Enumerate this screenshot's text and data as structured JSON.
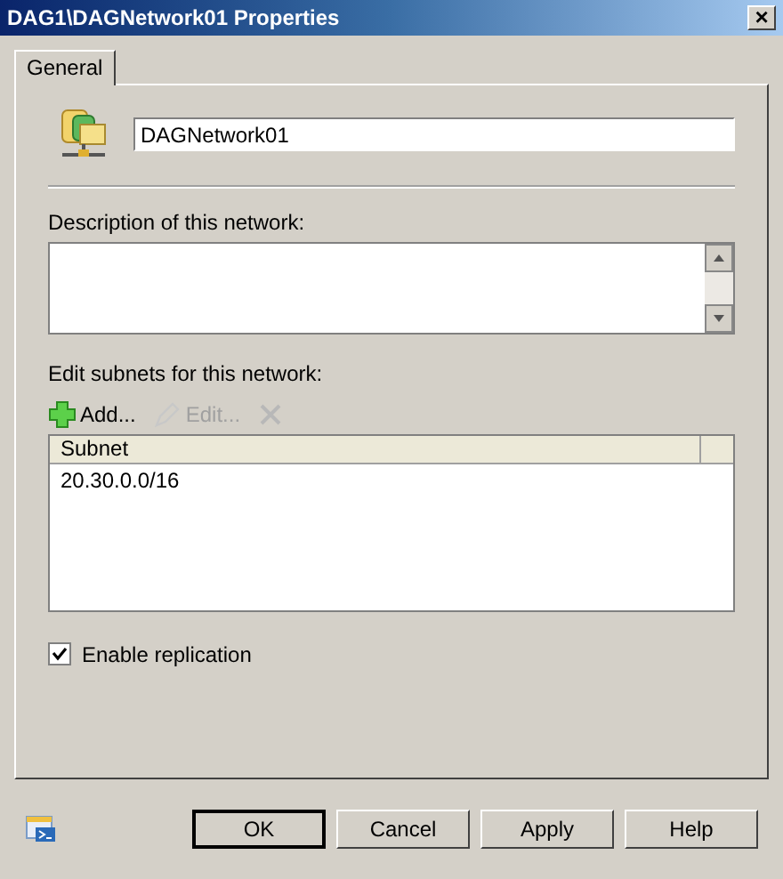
{
  "window": {
    "title": "DAG1\\DAGNetwork01 Properties",
    "close": "×"
  },
  "tabs": [
    {
      "label": "General",
      "selected": true
    }
  ],
  "name_field": {
    "value": "DAGNetwork01"
  },
  "description": {
    "label": "Description of this network:"
  },
  "subnets": {
    "label": "Edit subnets for this network:",
    "toolbar": [
      {
        "kind": "add",
        "label": "Add...",
        "disabled": false
      },
      {
        "kind": "edit",
        "label": "Edit...",
        "disabled": true
      },
      {
        "kind": "delete",
        "disabled": true
      }
    ],
    "columns": [
      "Subnet"
    ],
    "rows": [
      {
        "cells": [
          "20.30.0.0/16"
        ],
        "selected": false
      }
    ]
  },
  "enable_replication": {
    "label": "Enable replication",
    "checked": true
  },
  "buttons": [
    {
      "label": "OK",
      "default": true
    },
    {
      "label": "Cancel",
      "default": false
    },
    {
      "label": "Apply",
      "default": false
    },
    {
      "label": "Help",
      "default": false
    }
  ]
}
